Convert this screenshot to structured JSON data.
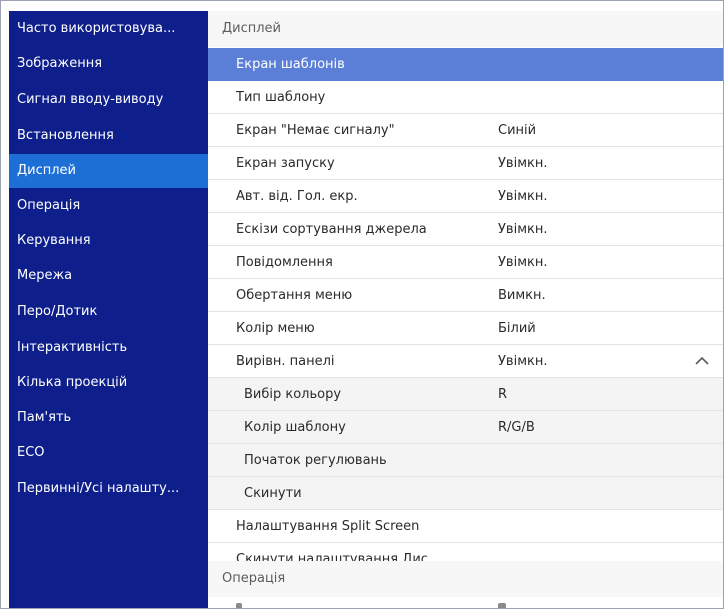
{
  "sidebar": {
    "items": [
      {
        "label": "Часто використовува...",
        "active": false
      },
      {
        "label": "Зображення",
        "active": false
      },
      {
        "label": "Сигнал вводу-виводу",
        "active": false
      },
      {
        "label": "Встановлення",
        "active": false
      },
      {
        "label": "Дисплей",
        "active": true
      },
      {
        "label": "Операція",
        "active": false
      },
      {
        "label": "Керування",
        "active": false
      },
      {
        "label": "Мережа",
        "active": false
      },
      {
        "label": "Перо/Дотик",
        "active": false
      },
      {
        "label": "Інтерактивність",
        "active": false
      },
      {
        "label": "Кілька проекцій",
        "active": false
      },
      {
        "label": "Пам'ять",
        "active": false
      },
      {
        "label": "ECO",
        "active": false
      },
      {
        "label": "Первинні/Усі налашту...",
        "active": false
      }
    ]
  },
  "main": {
    "section_title": "Дисплей",
    "rows": [
      {
        "label": "Екран шаблонів",
        "value": "",
        "selected": true
      },
      {
        "label": "Тип шаблону",
        "value": ""
      },
      {
        "label": "Екран \"Немає сигналу\"",
        "value": "Синій"
      },
      {
        "label": "Екран запуску",
        "value": "Увімкн."
      },
      {
        "label": "Авт. від. Гол. екр.",
        "value": "Увімкн."
      },
      {
        "label": "Ескізи сортування джерела",
        "value": "Увімкн."
      },
      {
        "label": "Повідомлення",
        "value": "Увімкн."
      },
      {
        "label": "Обертання меню",
        "value": "Вимкн."
      },
      {
        "label": "Колір меню",
        "value": "Білий"
      },
      {
        "label": "Вирівн. панелі",
        "value": "Увімкн.",
        "expanded": true,
        "icon": "chevron-up-icon"
      },
      {
        "label": "Вибір кольору",
        "value": "R",
        "sub": true
      },
      {
        "label": "Колір шаблону",
        "value": "R/G/B",
        "sub": true
      },
      {
        "label": "Початок регулювань",
        "value": "",
        "sub": true
      },
      {
        "label": "Скинути",
        "value": "",
        "sub": true
      },
      {
        "label": "Налаштування Split Screen",
        "value": ""
      },
      {
        "label": "Скинути налаштування Дис...",
        "value": ""
      }
    ],
    "next_section_title": "Операція"
  },
  "colors": {
    "sidebar_bg": "#0e1f8c",
    "sidebar_active": "#1d6fd6",
    "row_selected": "#5b7fd6"
  }
}
